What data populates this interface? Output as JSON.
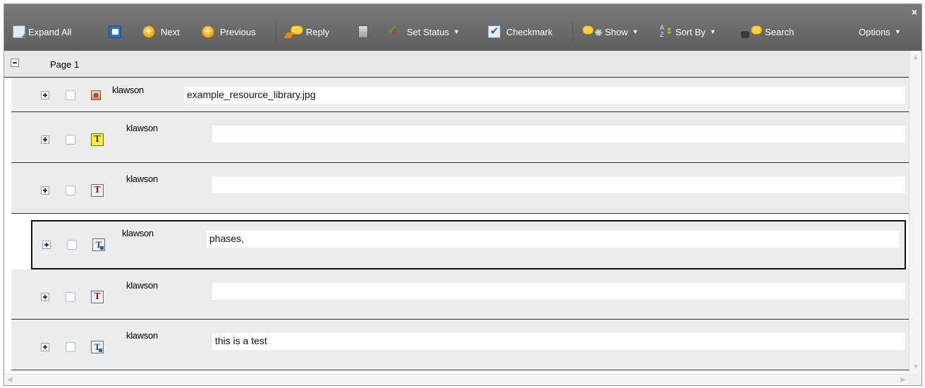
{
  "toolbar": {
    "expand_all": "Expand All",
    "next": "Next",
    "previous": "Previous",
    "reply": "Reply",
    "set_status": "Set Status",
    "checkmark": "Checkmark",
    "show": "Show",
    "sort_by": "Sort By",
    "search": "Search",
    "options": "Options",
    "close": "×",
    "caret": "▼"
  },
  "page": {
    "label": "Page 1"
  },
  "items": [
    {
      "author": "klawson",
      "text": "example_resource_library.jpg",
      "icon": "file-attachment-icon"
    },
    {
      "author": "klawson",
      "text": "",
      "icon": "text-note-icon"
    },
    {
      "author": "klawson",
      "text": "",
      "icon": "strikethrough-icon"
    },
    {
      "author": "klawson",
      "text": "phases,",
      "icon": "insert-text-icon"
    },
    {
      "author": "klawson",
      "text": "",
      "icon": "strikethrough-icon"
    },
    {
      "author": "klawson",
      "text": "this is a test",
      "icon": "replace-text-icon"
    }
  ],
  "glyphs": {
    "text_note": "T",
    "strike": "T",
    "insert": "T",
    "replace": "T"
  },
  "colors": {
    "toolbar_bg": "#6c6c6c",
    "row_bg": "#ececec",
    "accent": "#2f6db5"
  }
}
